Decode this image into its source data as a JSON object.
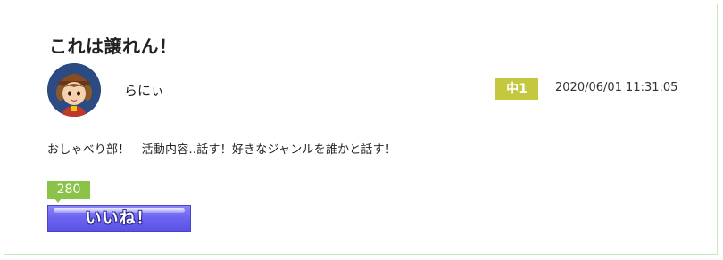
{
  "post": {
    "title": "これは譲れん！",
    "author": {
      "name": "らにぃ",
      "avatar_icon": "user-avatar-icon"
    },
    "grade": "中1",
    "timestamp": "2020/06/01 11:31:05",
    "body": "おしゃべり部！　活動内容‥話す！好きなジャンルを誰かと話す！",
    "likes": {
      "count": "280",
      "button_label": "いいね！"
    }
  },
  "colors": {
    "card_border": "#c8e6c2",
    "grade_badge": "#c4c83f",
    "like_count_badge": "#8bc34a",
    "like_button": "#6d66f0"
  }
}
